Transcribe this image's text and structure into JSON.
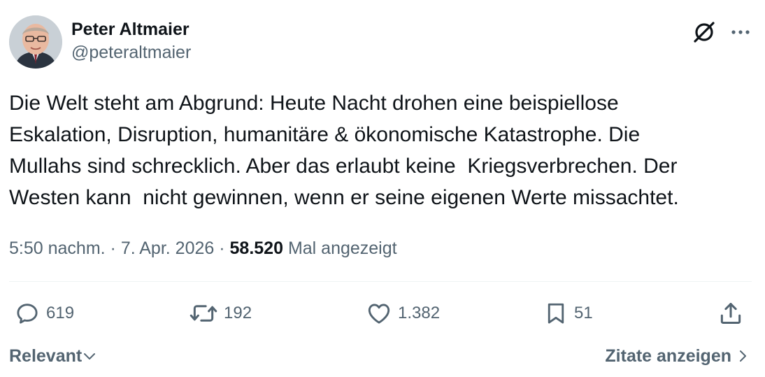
{
  "author": {
    "display_name": "Peter Altmaier",
    "handle": "@peteraltmaier"
  },
  "tweet": {
    "text": "Die Welt steht am Abgrund: Heute Nacht drohen eine beispiellose\nEskalation, Disruption, humanitäre & ökonomische Katastrophe. Die\nMullahs sind schrecklich. Aber das erlaubt keine  Kriegsverbrechen. Der\nWesten kann  nicht gewinnen, wenn er seine eigenen Werte missachtet."
  },
  "meta": {
    "time": "5:50 nachm.",
    "separator": "·",
    "date": "7. Apr. 2026",
    "views_count": "58.520",
    "views_label": "Mal angezeigt"
  },
  "actions": {
    "replies": "619",
    "retweets": "192",
    "likes": "1.382",
    "bookmarks": "51"
  },
  "footer": {
    "sort_label": "Relevant",
    "quotes_label": "Zitate anzeigen"
  },
  "icons": {
    "grok": "grok-icon",
    "more": "more-icon",
    "reply": "reply-icon",
    "retweet": "retweet-icon",
    "like": "heart-icon",
    "bookmark": "bookmark-icon",
    "share": "share-icon"
  }
}
